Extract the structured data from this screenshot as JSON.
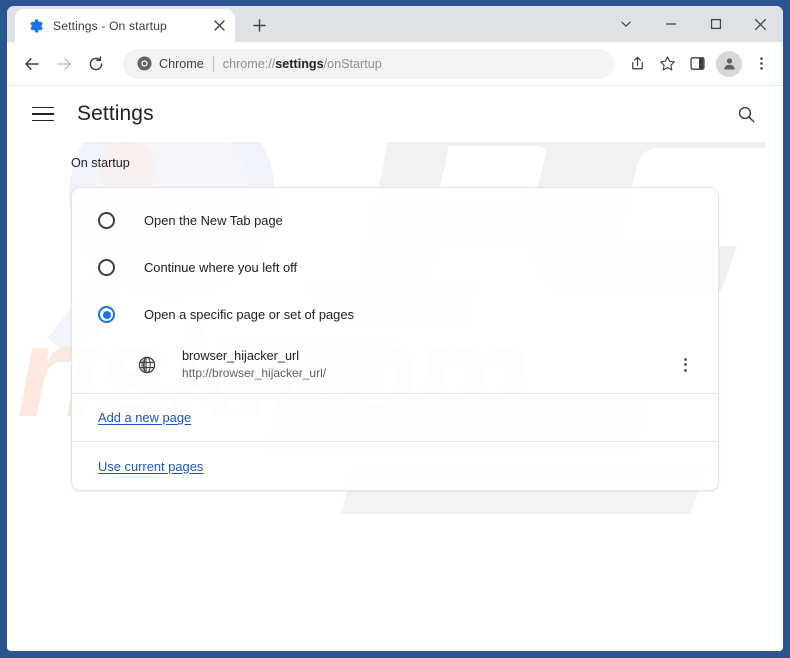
{
  "window": {
    "frame_color": "#2c5590",
    "controls": [
      {
        "name": "chevron-down",
        "glyph": "⌄"
      },
      {
        "name": "minimize",
        "glyph": "–"
      },
      {
        "name": "maximize",
        "glyph": "□"
      },
      {
        "name": "close",
        "glyph": "×"
      }
    ]
  },
  "tabstrip": {
    "tab": {
      "title": "Settings - On startup",
      "favicon": "gear-icon",
      "close_label": "×"
    },
    "new_tab_label": "+"
  },
  "toolbar": {
    "back_label": "←",
    "forward_label": "→",
    "reload_label": "↻",
    "omnibox": {
      "chip_icon": "chrome-logo-icon",
      "chip_label": "Chrome",
      "url_prefix": "chrome://",
      "url_bold": "settings",
      "url_suffix": "/onStartup"
    },
    "share_icon": "share-icon",
    "bookmark_icon": "star-icon",
    "sidepanel_icon": "side-panel-icon",
    "profile_icon": "avatar-icon",
    "menu_icon": "three-dot-menu-icon"
  },
  "settings_page": {
    "menu_icon": "hamburger-icon",
    "title": "Settings",
    "search_icon": "search-icon",
    "section_label": "On startup",
    "options": [
      {
        "label": "Open the New Tab page",
        "selected": false
      },
      {
        "label": "Continue where you left off",
        "selected": false
      },
      {
        "label": "Open a specific page or set of pages",
        "selected": true
      }
    ],
    "startup_entry": {
      "icon": "globe-icon",
      "name": "browser_hijacker_url",
      "url": "http://browser_hijacker_url/",
      "menu_icon": "three-dot-menu-icon"
    },
    "links": [
      {
        "label": "Add a new page"
      },
      {
        "label": "Use current pages"
      }
    ]
  },
  "watermark": {
    "logo_text": "PC",
    "domain_text": "risk.com",
    "logo_color": "#f0f1f2",
    "domain_color": "#fbeae2",
    "glass_color": "#e9edf5"
  },
  "colors": {
    "accent": "#1a73e8",
    "link": "#1a56c4",
    "text_primary": "#202124",
    "text_secondary": "#5f6368"
  }
}
